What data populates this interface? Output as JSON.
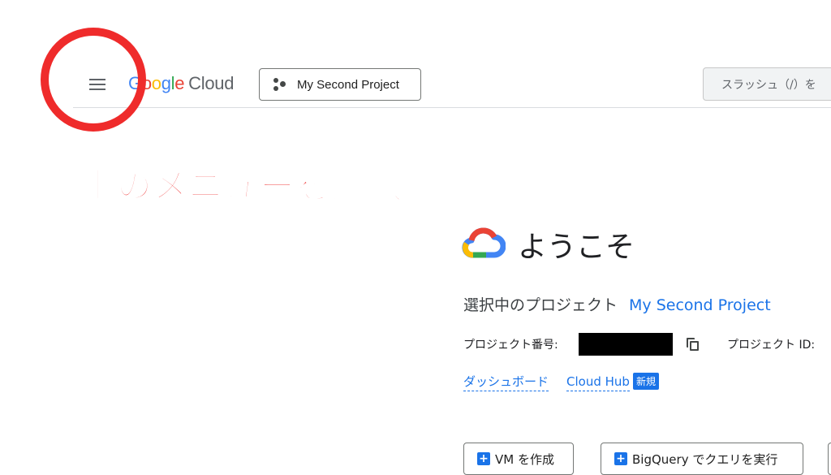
{
  "header": {
    "logo": {
      "google": [
        "G",
        "o",
        "o",
        "g",
        "l",
        "e"
      ],
      "google_colors": [
        "#4285F4",
        "#EA4335",
        "#FBBC05",
        "#4285F4",
        "#34A853",
        "#EA4335"
      ],
      "cloud": "Cloud"
    },
    "menu_icon": "hamburger-menu-icon",
    "project_picker_label": "My Second Project",
    "search_placeholder": "スラッシュ（/）を"
  },
  "annotation": {
    "text": "左上のメニューを選択",
    "color": "#EE2B2B"
  },
  "welcome": {
    "title": "ようこそ",
    "icon": "google-cloud-logo-icon"
  },
  "project_info": {
    "selected_label": "選択中のプロジェクト",
    "selected_project": "My Second Project",
    "number_label": "プロジェクト番号:",
    "id_label": "プロジェクト ID:"
  },
  "links": {
    "dashboard": "ダッシュボード",
    "cloud_hub": "Cloud Hub",
    "new_badge": "新規"
  },
  "actions": {
    "create_vm": "VM を作成",
    "bigquery": "BigQuery でクエリを実行"
  },
  "colors": {
    "accent": "#1A73E8",
    "annotation_red": "#EF2B2B"
  }
}
